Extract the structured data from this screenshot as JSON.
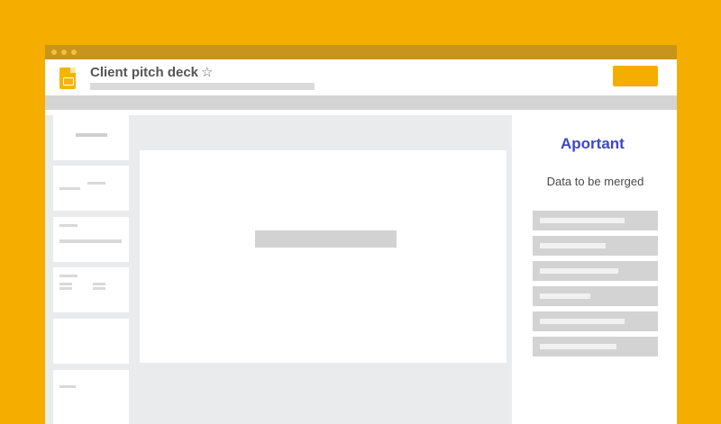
{
  "document": {
    "title": "Client pitch deck",
    "star_glyph": "☆"
  },
  "icons": {
    "app": "slides-icon",
    "star": "star-icon"
  },
  "colors": {
    "background": "#F5AE00",
    "window_bar": "#C9941C",
    "share_button": "#F5AE00",
    "portant_brand": "#3B48C4"
  },
  "sidebar": {
    "brand": {
      "glyph": "A",
      "text": "portant"
    },
    "heading": "Data to be merged"
  }
}
